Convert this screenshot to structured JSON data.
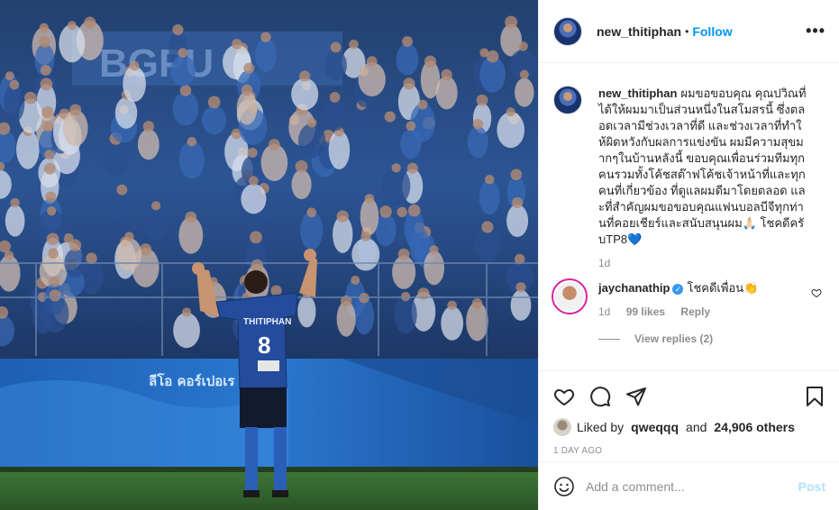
{
  "post": {
    "username": "new_thitiphan",
    "dot": "•",
    "follow_label": "Follow",
    "more_icon": "more-horizontal-icon",
    "caption": "ผมขอขอบคุณ คุณปวิณที่ได้ให้ผมมาเป็นส่วนหนึ่งในสโมสรนี้ ซึ่งตลอดเวลามีช่วงเวลาที่ดี และช่วงเวลาที่ทำให้ผิดหวังกับผลการแข่งขัน ผมมีความสุขมากๆในบ้านหลังนี้ ขอบคุณเพื่อนร่วมทีมทุกคนรวมทั้งโค้ชสต๊าฟโค้ชเจ้าหน้าที่และทุกคนที่เกี่ยวข้อง ที่ดูแลผมดีมาโดยตลอด และที่สำคัญผมขอขอบคุณแฟนบอลบีจีทุกท่านที่คอยเชียร์และสนับสนุนผม🙏🏻 โชคดีครับTP8💙",
    "caption_time": "1d"
  },
  "photo": {
    "jersey_name": "THITIPHAN",
    "jersey_number": "8",
    "board_text": "ลีโอ คอร์เปอเร",
    "stand_text": "BGPU"
  },
  "comment": {
    "username": "jaychanathip",
    "verified_mark": "✓",
    "text": "โชคดีเพื่อน👏",
    "time": "1d",
    "likes": "99 likes",
    "reply_label": "Reply",
    "view_replies": "View replies (2)"
  },
  "actions": {
    "liked_by_prefix": "Liked by",
    "liked_by_user": "qweqqq",
    "and": "and",
    "others": "24,906 others",
    "time_ago": "1 DAY AGO"
  },
  "add_comment": {
    "placeholder": "Add a comment...",
    "post_label": "Post"
  },
  "colors": {
    "accent": "#0095f6",
    "post_disabled": "#b2dffc",
    "muted": "#8e8e8e",
    "text": "#262626"
  }
}
